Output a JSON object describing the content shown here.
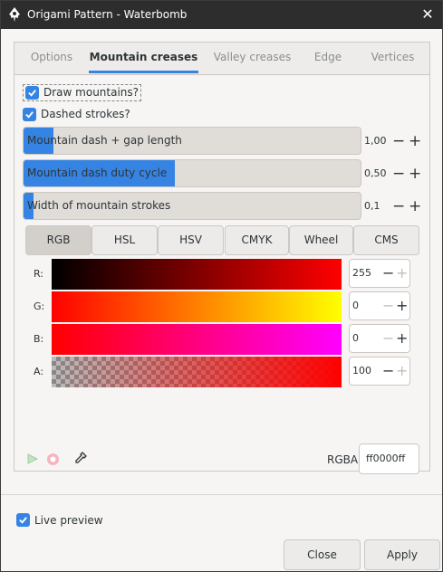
{
  "window": {
    "title": "Origami Pattern - Waterbomb",
    "close_glyph": "✕"
  },
  "tabs": [
    "Options",
    "Mountain creases",
    "Valley creases",
    "Edge",
    "Vertices"
  ],
  "active_tab": "Mountain creases",
  "checkboxes": {
    "draw_mountains": {
      "label": "Draw mountains?",
      "checked": true
    },
    "dashed_strokes": {
      "label": "Dashed strokes?",
      "checked": true
    }
  },
  "sliders": [
    {
      "label": "Mountain dash + gap length",
      "value": "1,00",
      "fill_fraction": 0.09
    },
    {
      "label": "Mountain dash duty cycle",
      "value": "0,50",
      "fill_fraction": 0.45
    },
    {
      "label": "Width of mountain strokes",
      "value": "0,1",
      "fill_fraction": 0.03
    }
  ],
  "color_modes": [
    "RGB",
    "HSL",
    "HSV",
    "CMYK",
    "Wheel",
    "CMS"
  ],
  "active_mode": "RGB",
  "channels": [
    {
      "label": "R:",
      "value": "255"
    },
    {
      "label": "G:",
      "value": "0"
    },
    {
      "label": "B:",
      "value": "0"
    },
    {
      "label": "A:",
      "value": "100"
    }
  ],
  "rgba": {
    "label": "RGBA:",
    "value": "ff0000ff"
  },
  "live_preview": {
    "label": "Live preview",
    "checked": true
  },
  "buttons": {
    "close": "Close",
    "apply": "Apply"
  },
  "colors": {
    "accent": "#3584e4",
    "titlebar": "#2d2d2d",
    "current": "#ff0000"
  }
}
